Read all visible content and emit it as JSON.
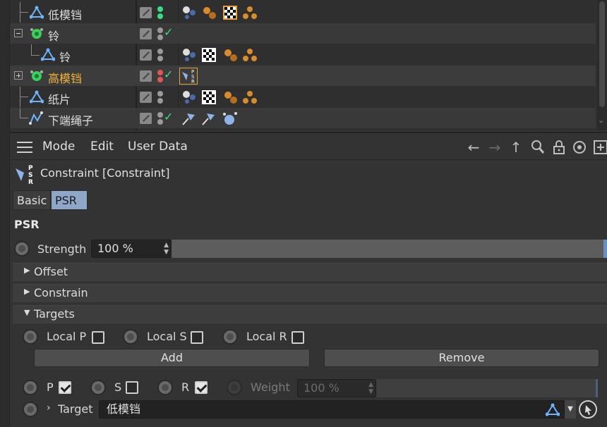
{
  "object_manager": {
    "rows": [
      {
        "label": "低模铛"
      },
      {
        "label": "铃"
      },
      {
        "label": "铃"
      },
      {
        "label": "高模铛"
      },
      {
        "label": "纸片"
      },
      {
        "label": "下端绳子"
      }
    ]
  },
  "attribute_manager": {
    "menu": {
      "mode": "Mode",
      "edit": "Edit",
      "user_data": "User Data"
    },
    "object_title": "Constraint [Constraint]",
    "tabs": {
      "basic": "Basic",
      "psr": "PSR"
    },
    "section": "PSR",
    "strength": {
      "label": "Strength",
      "value": "100 %",
      "slider_level": 1.0
    },
    "groups": {
      "offset": "Offset",
      "constrain": "Constrain",
      "targets": "Targets"
    },
    "local": {
      "p": "Local P",
      "s": "Local S",
      "r": "Local R"
    },
    "buttons": {
      "add": "Add",
      "remove": "Remove"
    },
    "target_row": {
      "p": "P",
      "s": "S",
      "r": "R",
      "weight_label": "Weight",
      "weight_value": "100 %",
      "target_label": "Target",
      "target_value": "低模铛"
    },
    "checks": {
      "local_p": false,
      "local_s": false,
      "local_r": false,
      "p": true,
      "s": false,
      "r": true
    }
  },
  "colors": {
    "accent": "#8ea6c8",
    "active_name": "#f3b53a",
    "check": "#3ddc84"
  }
}
